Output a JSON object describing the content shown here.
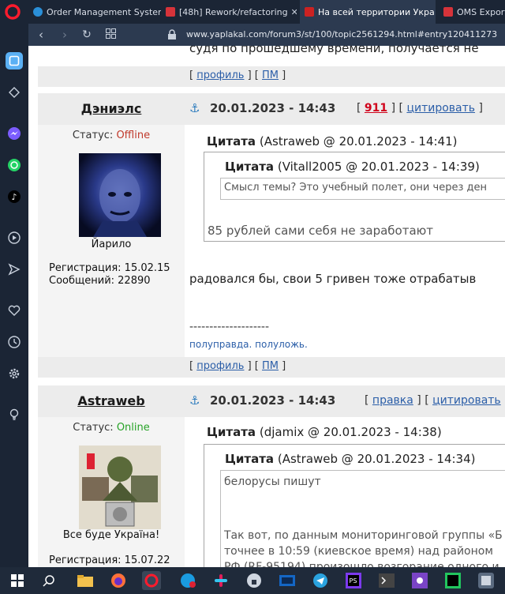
{
  "tabs": [
    {
      "title": "Order Management Syster",
      "active": false
    },
    {
      "title": "[48h] Rework/refactoring",
      "active": false
    },
    {
      "title": "На всей территории Укра",
      "active": true
    },
    {
      "title": "OMS Export -",
      "active": false
    }
  ],
  "address": {
    "url": "www.yaplakal.com/forum3/st/100/topic2561294.html#entry120411273"
  },
  "page": {
    "top_text": "судя по прошедшему времени, получается не",
    "profile_label": "профиль",
    "pm_label": "ПМ",
    "posts": [
      {
        "author": "Дэниэлс",
        "date": "20.01.2023 - 14:43",
        "rating": "911",
        "quote_label": "цитировать",
        "status_label": "Статус:",
        "status_value": "Offline",
        "avatar_caption": "Йарило",
        "reg": "Регистрация: 15.02.15",
        "msgs": "Сообщений: 22890",
        "q_outer_label": "Цитата",
        "q_outer_meta": "(Astraweb @ 20.01.2023 - 14:41)",
        "q_inner_label": "Цитата",
        "q_inner_meta": "(Vitall2005 @ 20.01.2023 - 14:39)",
        "q_inner_text": "Смысл темы? Это учебный полет, они через ден",
        "q_outer_text": "85 рублей сами себя не заработают",
        "body": "радовался бы, свои 5 гривен тоже отрабатыв",
        "sig_dashes": "--------------------",
        "signature": "полуправда. полуложь."
      },
      {
        "author": "Astraweb",
        "date": "20.01.2023 - 14:43",
        "edit_label": "правка",
        "quote_label": "цитировать",
        "status_label": "Статус:",
        "status_value": "Online",
        "avatar_caption": "Все буде Україна!",
        "reg": "Регистрация: 15.07.22",
        "q_outer_label": "Цитата",
        "q_outer_meta": "(djamix @ 20.01.2023 - 14:38)",
        "q_inner_label": "Цитата",
        "q_inner_meta": "(Astraweb @ 20.01.2023 - 14:34)",
        "q_inner_line1": "белорусы пишут",
        "q_inner_line2": "Так вот, по данным мониторинговой группы «Б",
        "q_inner_line3": "точнее в 10:59 (киевское время) над районом",
        "q_inner_line4": "РФ (RF-95194) произошло возгорание одного и"
      }
    ]
  },
  "colors": {
    "offline": "#c0392b",
    "online": "#27a327",
    "rating": "#d0021b",
    "link": "#2b5ea8"
  }
}
